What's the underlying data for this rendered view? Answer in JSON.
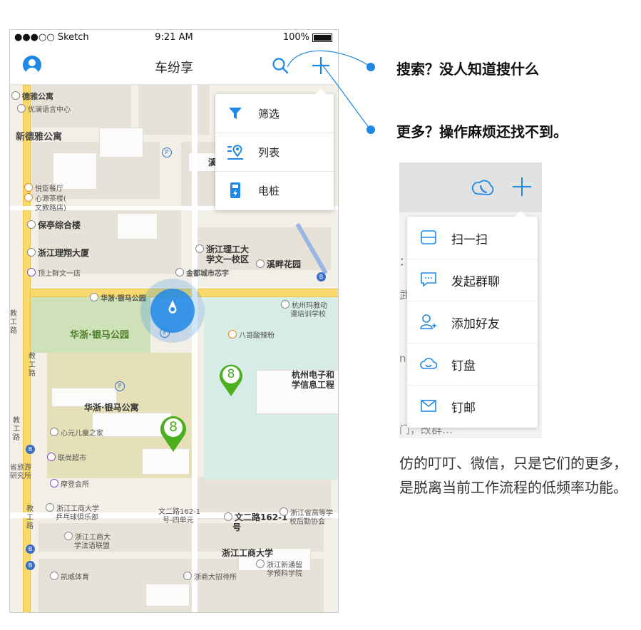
{
  "status_bar": {
    "carrier": "●●●○○ Sketch",
    "time": "9:21 AM",
    "battery": "100%"
  },
  "nav": {
    "title": "车纷享"
  },
  "menu": {
    "items": [
      {
        "label": "筛选",
        "icon": "filter-icon"
      },
      {
        "label": "列表",
        "icon": "list-location-icon"
      },
      {
        "label": "电桩",
        "icon": "charging-pile-icon"
      }
    ]
  },
  "map": {
    "labels": {
      "l1": "德雅公寓",
      "l2": "优澜语言中心",
      "l3": "新德雅公寓",
      "l4": "悦臣餐厅",
      "l5": "心源茶楼(",
      "l6": "文教路店)",
      "l7": "保亭综合楼",
      "l8": "浙江理翔大厦",
      "l9": "顶上鲜文一店",
      "l10": "浙江理工大",
      "l11": "学文一校区",
      "l12": "溪畔花园",
      "l13": "金都城市芯宇",
      "l14": "华浙·银马公园",
      "l15": "杭州玛雅动",
      "l16": "漫培训学校",
      "l17": "八哥酸辣粉",
      "l18": "华浙·银马公园",
      "l19": "杭州电子和",
      "l20": "学信息工程",
      "l21": "华浙·银马公寓",
      "l22": "心元儿童之家",
      "l23": "联尚超市",
      "l24": "摩登会所",
      "l25": "浙江工商大学",
      "l26": "乒乓球俱乐部",
      "l27": "文二路162-1",
      "l28": "号-四单元",
      "l29": "文二路162-1",
      "l30": "号",
      "l31": "浙江省高等学",
      "l32": "校后勤协会",
      "l33": "浙江工商大",
      "l34": "学法语联盟",
      "l35": "浙江工商大学",
      "l36": "浙江新通留",
      "l37": "学预科学院",
      "l38": "凯威体育",
      "l39": "浙商大招待所",
      "l40": "省旅游",
      "l41": "研究所",
      "l42": "溪",
      "r1": "教",
      "r2": "工",
      "r3": "路",
      "r4": "教",
      "r5": "工",
      "r6": "路",
      "r7": "教",
      "r8": "工",
      "r9": "路",
      "r10": "教",
      "r11": "工",
      "r12": "路"
    },
    "markers": [
      {
        "count": "8"
      },
      {
        "count": "8"
      }
    ],
    "parking": "P",
    "bus": "B"
  },
  "callouts": {
    "search": "搜索？没人知道搜什么",
    "more": "更多？操作麻烦还找不到。"
  },
  "reference": {
    "items": [
      {
        "label": "扫一扫",
        "icon": "scan-icon"
      },
      {
        "label": "发起群聊",
        "icon": "group-chat-icon"
      },
      {
        "label": "添加好友",
        "icon": "add-friend-icon"
      },
      {
        "label": "钉盘",
        "icon": "cloud-drive-icon"
      },
      {
        "label": "钉邮",
        "icon": "mail-icon"
      }
    ],
    "bg_text": {
      "t1": "：\"",
      "t2": "武",
      "t3": "n",
      "t4": "门，改群…"
    }
  },
  "description": "仿的叮叮、微信，只是它们的更多，是脱离当前工作流程的低频率功能。",
  "colors": {
    "accent": "#1e88e5",
    "marker": "#4caf1f"
  }
}
